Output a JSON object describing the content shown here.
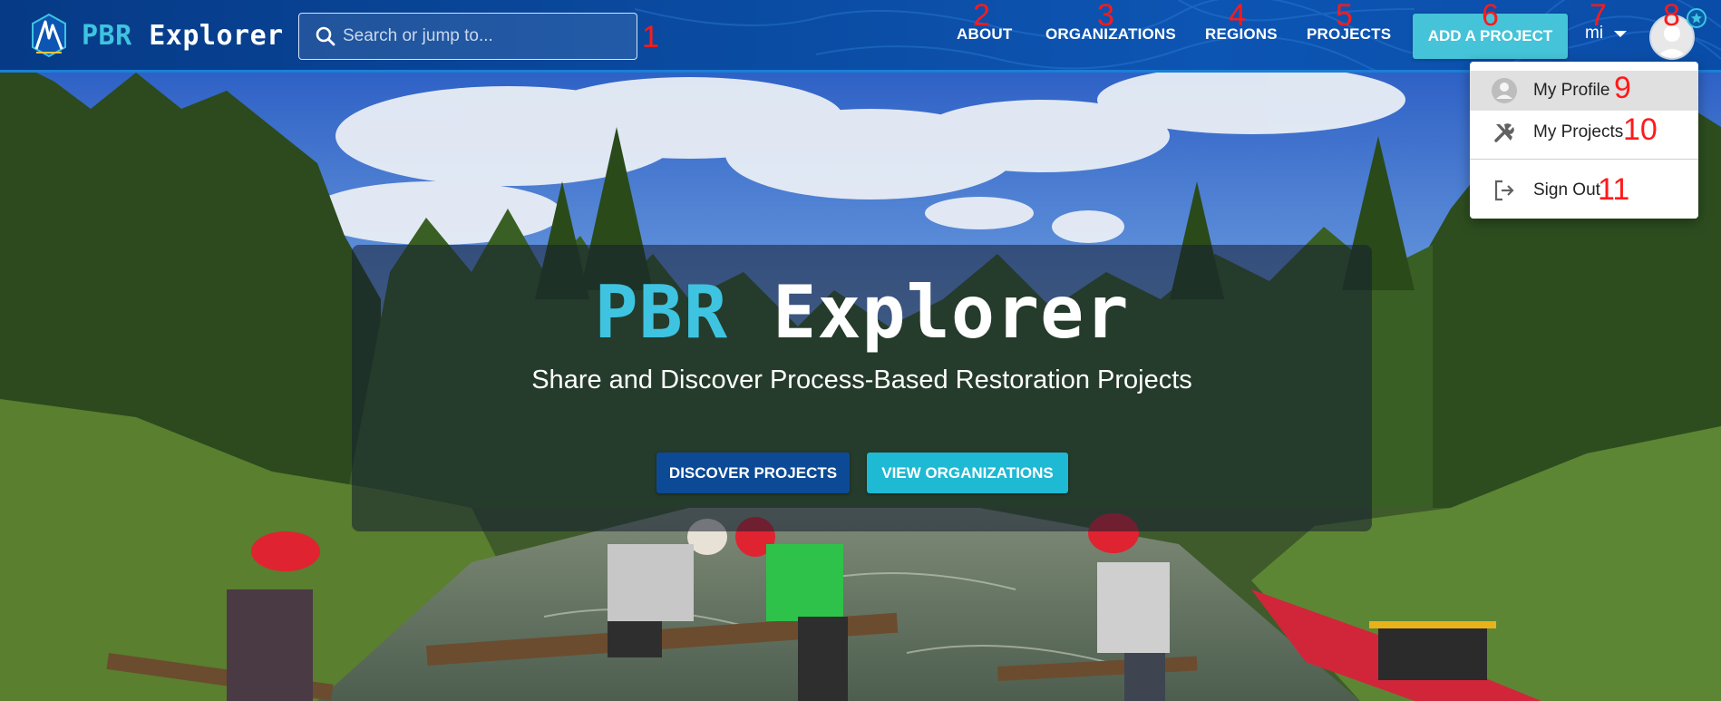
{
  "header": {
    "logo": {
      "primary": "PBR",
      "secondary": "Explorer"
    },
    "search": {
      "placeholder": "Search or jump to...",
      "value": ""
    },
    "nav": [
      {
        "label": "ABOUT"
      },
      {
        "label": "ORGANIZATIONS"
      },
      {
        "label": "REGIONS"
      },
      {
        "label": "PROJECTS"
      }
    ],
    "add_project_label": "ADD A PROJECT",
    "unit_label": "mi"
  },
  "user_menu": {
    "items": [
      {
        "label": "My Profile",
        "icon": "person-icon"
      },
      {
        "label": "My Projects",
        "icon": "tools-icon"
      },
      {
        "label": "Sign Out",
        "icon": "logout-icon"
      }
    ]
  },
  "hero": {
    "title_primary": "PBR",
    "title_secondary": "Explorer",
    "subtitle": "Share and Discover Process-Based Restoration Projects",
    "discover_label": "DISCOVER PROJECTS",
    "orgs_label": "VIEW ORGANIZATIONS"
  },
  "annotations": [
    "1",
    "2",
    "3",
    "4",
    "5",
    "6",
    "7",
    "8",
    "9",
    "10",
    "11"
  ],
  "colors": {
    "nav_bg": "#0a4aa0",
    "accent_cyan": "#3ec4e0",
    "button_dark": "#0c4a96",
    "button_cyan": "#1eb9d3",
    "marker_red": "#ff1a1a"
  }
}
